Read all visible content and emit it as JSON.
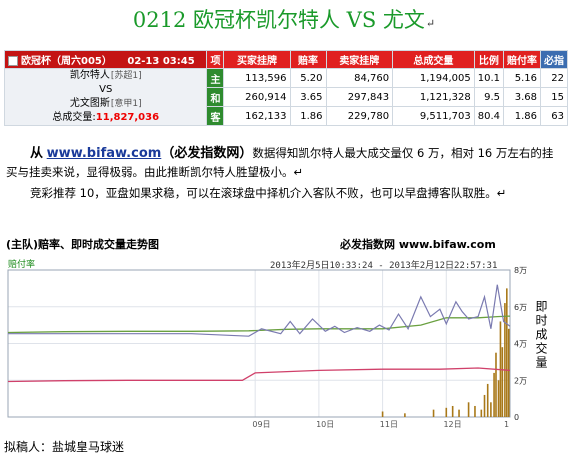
{
  "title": {
    "text": "0212 欧冠杯凯尔特人 VS 尤文",
    "mark": "↵"
  },
  "table": {
    "league": "欧冠杯（周六005）",
    "datetime": "02-13 03:45",
    "headers": [
      "项",
      "买家挂牌",
      "赔率",
      "卖家挂牌",
      "总成交量",
      "比例",
      "赔付率",
      "必指"
    ],
    "home_team": "凯尔特人",
    "home_tag": "[苏超1]",
    "vs": "VS",
    "away_team": "尤文图斯",
    "away_tag": "[意甲1]",
    "total_label": "总成交量:",
    "total_value": "11,827,036",
    "rows": [
      {
        "item": "主",
        "buyer": "113,596",
        "odds": "5.20",
        "seller": "84,760",
        "volume": "1,194,005",
        "ratio": "10.1",
        "payout": "5.16",
        "index": "22"
      },
      {
        "item": "和",
        "buyer": "260,914",
        "odds": "3.65",
        "seller": "297,843",
        "volume": "1,121,328",
        "ratio": "9.5",
        "payout": "3.68",
        "index": "15"
      },
      {
        "item": "客",
        "buyer": "162,133",
        "odds": "1.86",
        "seller": "229,780",
        "volume": "9,511,703",
        "ratio": "80.4",
        "payout": "1.86",
        "index": "63"
      }
    ]
  },
  "paragraph1": {
    "from": "从",
    "link": "www.bifaw.com",
    "brand": "（必发指数网）",
    "text": "数据得知凯尔特人最大成交量仅 6 万，相对 16 万左右的挂买与挂卖来说，显得极弱。由此推断凯尔特人胜望极小。↵"
  },
  "paragraph2": {
    "text": "竞彩推荐 10，亚盘如果求稳，可以在滚球盘中择机介入客队不败，也可以早盘搏客队取胜。↵"
  },
  "chart_data": {
    "type": "line",
    "title": "(主队)赔率、即时成交量走势图",
    "brand": "必发指数网 www.bifaw.com",
    "legend": "赔付率",
    "range_text": "2013年2月5日10:33:24 - 2013年2月12日22:57:31",
    "xlabels": [
      "09日",
      "10日",
      "11日",
      "12日",
      "1"
    ],
    "y2_ticks": [
      "8万",
      "6万",
      "4万",
      "2万",
      "0"
    ],
    "y2_title": "即时成交量",
    "grid": true,
    "colors": {
      "purple": "#7a7ab0",
      "green": "#6aa040",
      "red": "#d0406a",
      "bars": "#a87818"
    },
    "series_purple": [
      [
        5.12,
        4.9
      ],
      [
        6.0,
        4.9
      ],
      [
        7.0,
        4.9
      ],
      [
        8.0,
        4.9
      ],
      [
        8.9,
        4.8
      ],
      [
        9.1,
        5.1
      ],
      [
        9.4,
        4.9
      ],
      [
        9.55,
        5.4
      ],
      [
        9.7,
        4.9
      ],
      [
        9.9,
        5.5
      ],
      [
        10.1,
        5.0
      ],
      [
        10.25,
        5.2
      ],
      [
        10.4,
        4.95
      ],
      [
        10.6,
        5.15
      ],
      [
        10.8,
        5.0
      ],
      [
        10.95,
        5.25
      ],
      [
        11.1,
        5.05
      ],
      [
        11.25,
        5.7
      ],
      [
        11.4,
        5.1
      ],
      [
        11.6,
        6.4
      ],
      [
        11.75,
        5.6
      ],
      [
        11.9,
        5.9
      ],
      [
        12.0,
        5.3
      ],
      [
        12.15,
        6.2
      ],
      [
        12.25,
        5.8
      ],
      [
        12.35,
        5.5
      ],
      [
        12.5,
        5.6
      ],
      [
        12.6,
        6.4
      ],
      [
        12.7,
        5.1
      ],
      [
        12.8,
        6.9
      ],
      [
        12.9,
        5.4
      ],
      [
        13.0,
        5.2
      ]
    ],
    "series_green": [
      [
        5.12,
        4.95
      ],
      [
        6.0,
        4.98
      ],
      [
        7.0,
        5.0
      ],
      [
        8.0,
        5.0
      ],
      [
        8.9,
        5.02
      ],
      [
        9.5,
        5.08
      ],
      [
        10.0,
        5.1
      ],
      [
        11.0,
        5.1
      ],
      [
        11.6,
        5.25
      ],
      [
        12.0,
        5.55
      ],
      [
        12.5,
        5.55
      ],
      [
        12.8,
        5.6
      ],
      [
        13.0,
        5.62
      ]
    ],
    "series_red": [
      [
        5.12,
        2.95
      ],
      [
        6.0,
        2.98
      ],
      [
        7.0,
        3.0
      ],
      [
        8.0,
        3.0
      ],
      [
        8.8,
        3.0
      ],
      [
        9.0,
        3.3
      ],
      [
        10.0,
        3.4
      ],
      [
        11.0,
        3.45
      ],
      [
        11.9,
        3.45
      ],
      [
        12.5,
        3.5
      ],
      [
        13.0,
        3.4
      ]
    ],
    "bars": [
      [
        11.0,
        3
      ],
      [
        11.35,
        2
      ],
      [
        11.8,
        4
      ],
      [
        12.0,
        5
      ],
      [
        12.1,
        6
      ],
      [
        12.2,
        4
      ],
      [
        12.35,
        8
      ],
      [
        12.45,
        6
      ],
      [
        12.55,
        4
      ],
      [
        12.6,
        12
      ],
      [
        12.65,
        18
      ],
      [
        12.7,
        8
      ],
      [
        12.75,
        24
      ],
      [
        12.78,
        35
      ],
      [
        12.82,
        20
      ],
      [
        12.85,
        52
      ],
      [
        12.88,
        38
      ],
      [
        12.92,
        62
      ],
      [
        12.95,
        70
      ],
      [
        12.98,
        48
      ]
    ]
  },
  "footer": {
    "text": "拟稿人：盐城皇马球迷"
  }
}
